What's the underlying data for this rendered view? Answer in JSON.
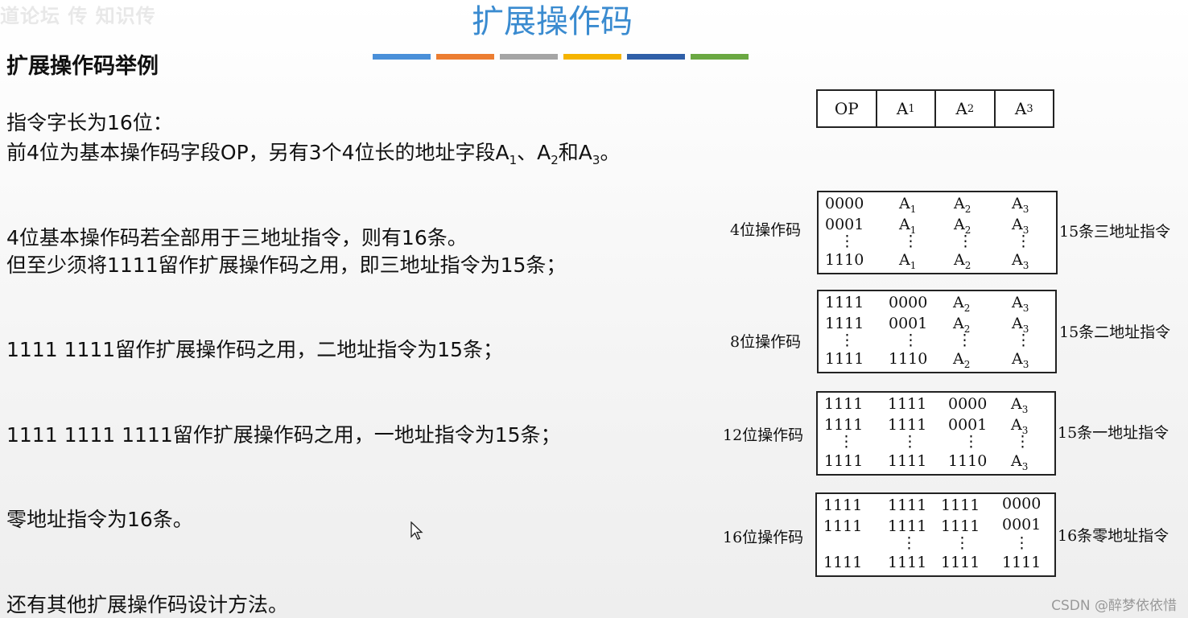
{
  "watermark": "道论坛  传 知识传",
  "title": "扩展操作码",
  "subtitle": "扩展操作码举例",
  "colors": {
    "title": "#3a8bd0",
    "bars": [
      "#4a90d9",
      "#ec7d31",
      "#a5a5a5",
      "#f5b400",
      "#2f5fa8",
      "#6aa842"
    ]
  },
  "lines": {
    "l1": "指令字长为16位：",
    "l2a": "前4位为基本操作码字段OP，另有3个4位长的地址字段A",
    "l2s1": "1",
    "l2b": "、A",
    "l2s2": "2",
    "l2c": "和A",
    "l2s3": "3",
    "l2d": "。",
    "l3": "4位基本操作码若全部用于三地址指令，则有16条。",
    "l4": "但至少须将1111留作扩展操作码之用，即三地址指令为15条；",
    "l5": "1111 1111留作扩展操作码之用，二地址指令为15条；",
    "l6": "1111 1111 1111留作扩展操作码之用，一地址指令为15条；",
    "l7": "零地址指令为16条。",
    "l8": "还有其他扩展操作码设计方法。"
  },
  "format": {
    "op": "OP",
    "a": "A",
    "s1": "1",
    "s2": "2",
    "s3": "3"
  },
  "tables": {
    "t1": {
      "left": "4位操作码",
      "right": "15条三地址指令",
      "r1": [
        "0000",
        "A",
        "1",
        "A",
        "2",
        "A",
        "3"
      ],
      "r2": [
        "0001",
        "A",
        "1",
        "A",
        "2",
        "A",
        "3"
      ],
      "r3": [
        "1110",
        "A",
        "1",
        "A",
        "2",
        "A",
        "3"
      ]
    },
    "t2": {
      "left": "8位操作码",
      "right": "15条二地址指令",
      "r1": [
        "1111",
        "0000",
        "A",
        "2",
        "A",
        "3"
      ],
      "r2": [
        "1111",
        "0001",
        "A",
        "2",
        "A",
        "3"
      ],
      "r3": [
        "1111",
        "1110",
        "A",
        "2",
        "A",
        "3"
      ]
    },
    "t3": {
      "left": "12位操作码",
      "right": "15条一地址指令",
      "r1": [
        "1111",
        "1111",
        "0000",
        "A",
        "3"
      ],
      "r2": [
        "1111",
        "1111",
        "0001",
        "A",
        "3"
      ],
      "r3": [
        "1111",
        "1111",
        "1110",
        "A",
        "3"
      ]
    },
    "t4": {
      "left": "16位操作码",
      "right": "16条零地址指令",
      "r1": [
        "1111",
        "1111",
        "1111",
        "0000"
      ],
      "r2": [
        "1111",
        "1111",
        "1111",
        "0001"
      ],
      "r3": [
        "1111",
        "1111",
        "1111",
        "1111"
      ]
    },
    "vdots": "⋮"
  },
  "credit": "CSDN @醉梦依依惜"
}
